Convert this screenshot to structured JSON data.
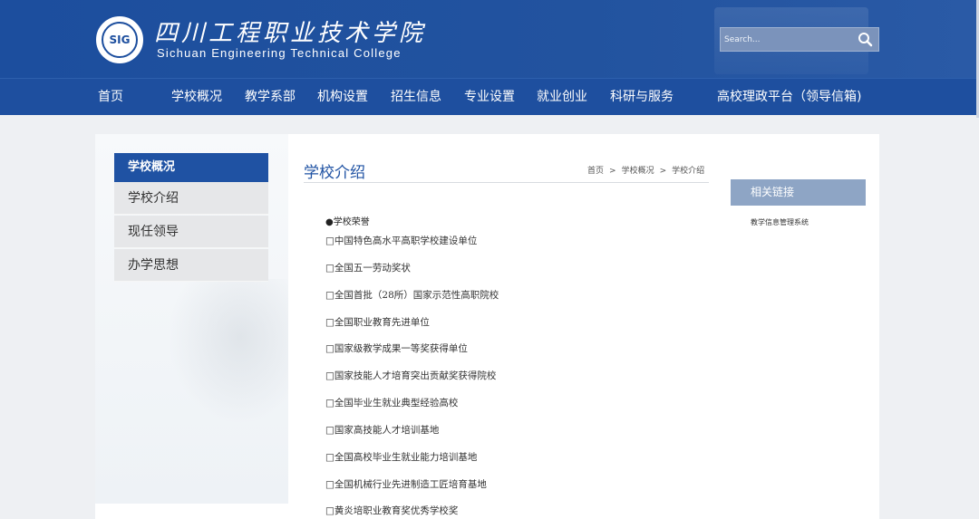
{
  "header": {
    "school_name_cn": "四川工程职业技术学院",
    "school_name_en": "Sichuan Engineering Technical College",
    "logo_text": "SIG"
  },
  "search": {
    "placeholder": "Search...",
    "icon": "search-icon"
  },
  "nav": {
    "items": [
      {
        "label": "首页"
      },
      {
        "label": "学校概况"
      },
      {
        "label": "教学系部"
      },
      {
        "label": "机构设置"
      },
      {
        "label": "招生信息"
      },
      {
        "label": "专业设置"
      },
      {
        "label": "就业创业"
      },
      {
        "label": "科研与服务"
      },
      {
        "label": "高校理政平台（领导信箱)"
      }
    ]
  },
  "sidebar": {
    "title": "学校概况",
    "items": [
      {
        "label": "学校介绍"
      },
      {
        "label": "现任领导"
      },
      {
        "label": "办学思想"
      }
    ]
  },
  "main": {
    "title": "学校介绍",
    "breadcrumb": [
      "首页",
      "学校概况",
      "学校介绍"
    ],
    "breadcrumb_sep": ">",
    "honor_heading": "●学校荣誉",
    "honors": [
      "□中国特色高水平高职学校建设单位",
      "□全国五一劳动奖状",
      "□全国首批（28所）国家示范性高职院校",
      "□全国职业教育先进单位",
      "□国家级教学成果一等奖获得单位",
      "□国家技能人才培育突出贡献奖获得院校",
      "□全国毕业生就业典型经验高校",
      "□国家高技能人才培训基地",
      "□全国高校毕业生就业能力培训基地",
      "□全国机械行业先进制造工匠培育基地",
      "□黄炎培职业教育奖优秀学校奖"
    ]
  },
  "related": {
    "title": "相关链接",
    "links": [
      {
        "label": "教学信息管理系统"
      }
    ]
  },
  "colors": {
    "brand_blue": "#1f52a3",
    "header_blue": "#1c4e9e",
    "related_box": "#8ea5c5",
    "sidebar_item_bg": "#e6e7e9"
  }
}
